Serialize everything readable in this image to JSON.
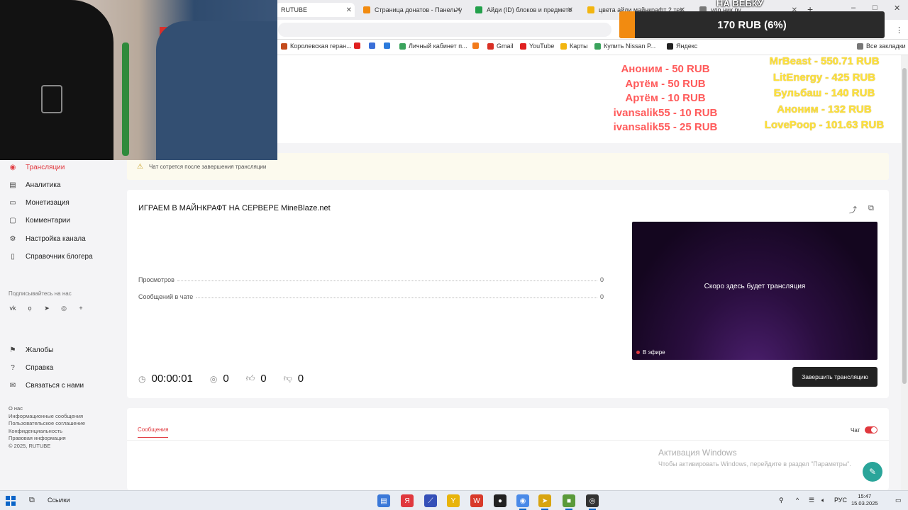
{
  "browser": {
    "tabs": [
      {
        "label": "RUTUBE",
        "color": "#e0383e",
        "active": true
      },
      {
        "label": "Страница донатов - Панель у",
        "color": "#f28b10",
        "active": false
      },
      {
        "label": "Айди (ID) блоков и предмето",
        "color": "#23a04b",
        "active": false
      },
      {
        "label": "цвета айди майнкрафт 2 тех",
        "color": "#f2b510",
        "active": false
      },
      {
        "label": "удо.ник.ру",
        "color": "#777777",
        "active": false
      }
    ],
    "new_tab": "+",
    "window_controls": [
      "–",
      "□",
      "✕"
    ],
    "bookmarks": [
      {
        "label": "Королевская геран...",
        "color": "#c44b1c"
      },
      {
        "label": "",
        "color": "#e02020"
      },
      {
        "label": "",
        "color": "#3a6fd8"
      },
      {
        "label": "",
        "color": "#2c7bdc"
      },
      {
        "label": "Личный кабинет п...",
        "color": "#3aa35c"
      },
      {
        "label": "",
        "color": "#f27a1a"
      },
      {
        "label": "Gmail",
        "color": "#d93025"
      },
      {
        "label": "YouTube",
        "color": "#e02020"
      },
      {
        "label": "Карты",
        "color": "#f2b510"
      },
      {
        "label": "Купить Nissan P...",
        "color": "#3aa35c"
      },
      {
        "label": "Яндекс",
        "color": "#222222"
      }
    ],
    "bookmarks_end": "Все закладки"
  },
  "sidebar": {
    "nav": [
      {
        "label": "Трансляции",
        "icon": "broadcast-icon",
        "glyph": "((•))",
        "active": true
      },
      {
        "label": "Аналитика",
        "icon": "analytics-icon",
        "glyph": "▤",
        "active": false
      },
      {
        "label": "Монетизация",
        "icon": "wallet-icon",
        "glyph": "▭",
        "active": false
      },
      {
        "label": "Комментарии",
        "icon": "comment-icon",
        "glyph": "▢",
        "active": false
      },
      {
        "label": "Настройка канала",
        "icon": "gear-icon",
        "glyph": "⚙",
        "active": false
      },
      {
        "label": "Справочник блогера",
        "icon": "book-icon",
        "glyph": "▯",
        "active": false
      }
    ],
    "follow_label": "Подписывайтесь на нас",
    "socials": [
      {
        "icon": "vk-icon",
        "glyph": "vk"
      },
      {
        "icon": "ok-icon",
        "glyph": "ọ"
      },
      {
        "icon": "telegram-icon",
        "glyph": "➤"
      },
      {
        "icon": "viber-icon",
        "glyph": "◎"
      },
      {
        "icon": "plus-icon",
        "glyph": "+"
      }
    ],
    "nav_bottom": [
      {
        "label": "Жалобы",
        "icon": "flag-icon",
        "glyph": "⚑"
      },
      {
        "label": "Справка",
        "icon": "help-icon",
        "glyph": "?"
      },
      {
        "label": "Связаться с нами",
        "icon": "mail-icon",
        "glyph": "✉"
      }
    ],
    "footer": [
      "О нас",
      "Информационные сообщения",
      "Пользовательское соглашение",
      "Конфиденциальность",
      "Правовая информация",
      "© 2025, RUTUBE"
    ]
  },
  "warning": {
    "text": "Чат сотрется после завершения трансляции"
  },
  "stream": {
    "title": "ИГРАЕМ В МАЙНКРАФТ НА СЕРВЕРЕ MineBlaze.net",
    "stats": [
      {
        "label": "Просмотров",
        "value": "0"
      },
      {
        "label": "Сообщений в чате",
        "value": "0"
      }
    ],
    "preview_text": "Скоро здесь будет трансляция",
    "live_label": "В эфире",
    "metrics": {
      "duration": "00:00:01",
      "viewers": "0",
      "likes": "0",
      "dislikes": "0"
    },
    "end_button": "Завершить трансляцию"
  },
  "chat": {
    "tab_label": "Сообщения",
    "toggle_label": "Чат",
    "enabled": true
  },
  "windows_activation": {
    "title": "Активация Windows",
    "subtitle": "Чтобы активировать Windows, перейдите в раздел \"Параметры\"."
  },
  "overlay": {
    "goal_title": "НА ВЕБКУ",
    "goal_text": "170 RUB (6%)",
    "goal_progress_percent": 6,
    "recent_donations": [
      "Аноним - 50 RUB",
      "Артём - 50 RUB",
      "Артём - 10 RUB",
      "ivansalik55 - 10 RUB",
      "ivansalik55 - 25 RUB"
    ],
    "top_donations": [
      "MrBeast - 550.71 RUB",
      "LitEnergy - 425 RUB",
      "Бульбаш - 140 RUB",
      "Аноним - 132 RUB",
      "LovePoop - 101.63 RUB"
    ]
  },
  "taskbar": {
    "search_label": "Ссылки",
    "language": "РУС",
    "time": "15:47",
    "date": "15.03.2025"
  }
}
